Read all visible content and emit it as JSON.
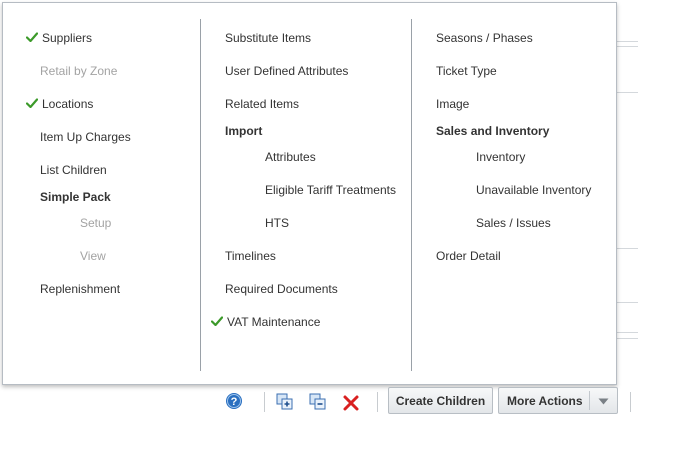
{
  "menu": {
    "col1": {
      "suppliers": "Suppliers",
      "retail_by_zone": "Retail by Zone",
      "locations": "Locations",
      "item_up_charges": "Item Up Charges",
      "list_children": "List Children",
      "simple_pack": "Simple Pack",
      "setup": "Setup",
      "view": "View",
      "replenishment": "Replenishment"
    },
    "col2": {
      "substitute_items": "Substitute Items",
      "user_defined_attributes": "User Defined Attributes",
      "related_items": "Related Items",
      "import": "Import",
      "attributes": "Attributes",
      "eligible_tariff_treatments": "Eligible Tariff Treatments",
      "hts": "HTS",
      "timelines": "Timelines",
      "required_documents": "Required Documents",
      "vat_maintenance": "VAT Maintenance"
    },
    "col3": {
      "seasons_phases": "Seasons / Phases",
      "ticket_type": "Ticket Type",
      "image": "Image",
      "sales_and_inventory": "Sales and Inventory",
      "inventory": "Inventory",
      "unavailable_inventory": "Unavailable Inventory",
      "sales_issues": "Sales / Issues",
      "order_detail": "Order Detail"
    }
  },
  "toolbar": {
    "create_children": "Create Children",
    "more_actions": "More Actions",
    "icons": [
      "help-icon",
      "expand-all-icon",
      "collapse-all-icon",
      "delete-icon",
      "dropdown-arrow-icon"
    ]
  },
  "colors": {
    "check_green": "#3c9a2a",
    "help_blue": "#2a6fc0",
    "delete_red": "#d92020",
    "disabled_text": "#a3a3a3"
  }
}
